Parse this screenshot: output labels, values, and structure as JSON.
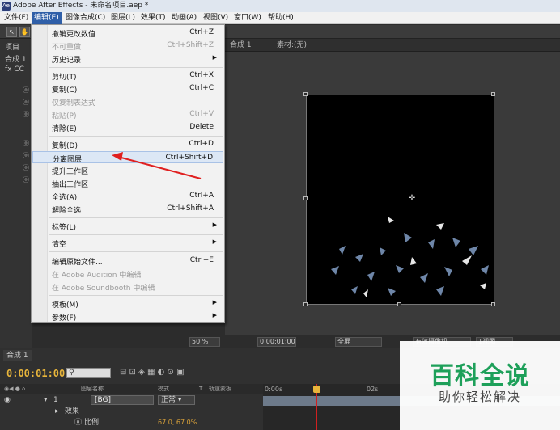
{
  "window": {
    "title": "Adobe After Effects - 未命名项目.aep *"
  },
  "menubar": {
    "items": [
      "文件(F)",
      "编辑(E)",
      "图像合成(C)",
      "图层(L)",
      "效果(T)",
      "动画(A)",
      "视图(V)",
      "窗口(W)",
      "帮助(H)"
    ]
  },
  "left_panel": {
    "project_tab": "项目",
    "comp_tab": "合成 1",
    "fx_label": "fx  CC"
  },
  "viewer": {
    "tab_dropdown": "合成 1",
    "footage_tab": "素材:(无)",
    "zoom": "50 %",
    "timecode": "0:00:01:00",
    "resolution": "全屏",
    "camera": "有效摄像机",
    "views": "1视图"
  },
  "edit_menu": {
    "items": [
      {
        "label": "撤销更改数值",
        "shortcut": "Ctrl+Z",
        "disabled": false
      },
      {
        "label": "不可重做",
        "shortcut": "Ctrl+Shift+Z",
        "disabled": true
      },
      {
        "label": "历史记录",
        "shortcut": "",
        "submenu": true
      },
      {
        "label": "剪切(T)",
        "shortcut": "Ctrl+X"
      },
      {
        "label": "复制(C)",
        "shortcut": "Ctrl+C"
      },
      {
        "label": "仅复制表达式",
        "shortcut": "",
        "disabled": true
      },
      {
        "label": "粘贴(P)",
        "shortcut": "Ctrl+V",
        "disabled": true
      },
      {
        "label": "清除(E)",
        "shortcut": "Delete"
      },
      {
        "label": "复制(D)",
        "shortcut": "Ctrl+D"
      },
      {
        "label": "分离图层",
        "shortcut": "Ctrl+Shift+D",
        "highlighted": true
      },
      {
        "label": "提升工作区",
        "shortcut": ""
      },
      {
        "label": "抽出工作区",
        "shortcut": ""
      },
      {
        "label": "全选(A)",
        "shortcut": "Ctrl+A"
      },
      {
        "label": "解除全选",
        "shortcut": "Ctrl+Shift+A"
      },
      {
        "label": "标签(L)",
        "shortcut": "",
        "submenu": true
      },
      {
        "label": "清空",
        "shortcut": "",
        "submenu": true
      },
      {
        "label": "编辑原始文件...",
        "shortcut": "Ctrl+E"
      },
      {
        "label": "在 Adobe Audition 中编辑",
        "shortcut": "",
        "disabled": true
      },
      {
        "label": "在 Adobe Soundbooth 中编辑",
        "shortcut": "",
        "disabled": true
      },
      {
        "label": "模板(M)",
        "shortcut": "",
        "submenu": true
      },
      {
        "label": "参数(F)",
        "shortcut": "",
        "submenu": true
      }
    ]
  },
  "timeline": {
    "tab": "合成 1",
    "current_time": "0:00:01:00",
    "col_source": "图层名称",
    "col_mode": "模式",
    "col_t": "T",
    "col_trkmat": "轨道蒙板",
    "layer_index": "1",
    "layer_name": "[BG]",
    "layer_mode": "正常",
    "effects_label": "效果",
    "scale_label": "比例",
    "scale_value": "67.0, 67.0%",
    "ruler_start": "0:00s",
    "ruler_2s": "02s"
  },
  "watermark": {
    "title": "百科全说",
    "subtitle": "助你轻松解决"
  },
  "colors": {
    "accent_menu": "#2f5fa8",
    "timecode": "#e8b53b",
    "watermark_green": "#1ea05a",
    "arrow_red": "#e02020"
  }
}
